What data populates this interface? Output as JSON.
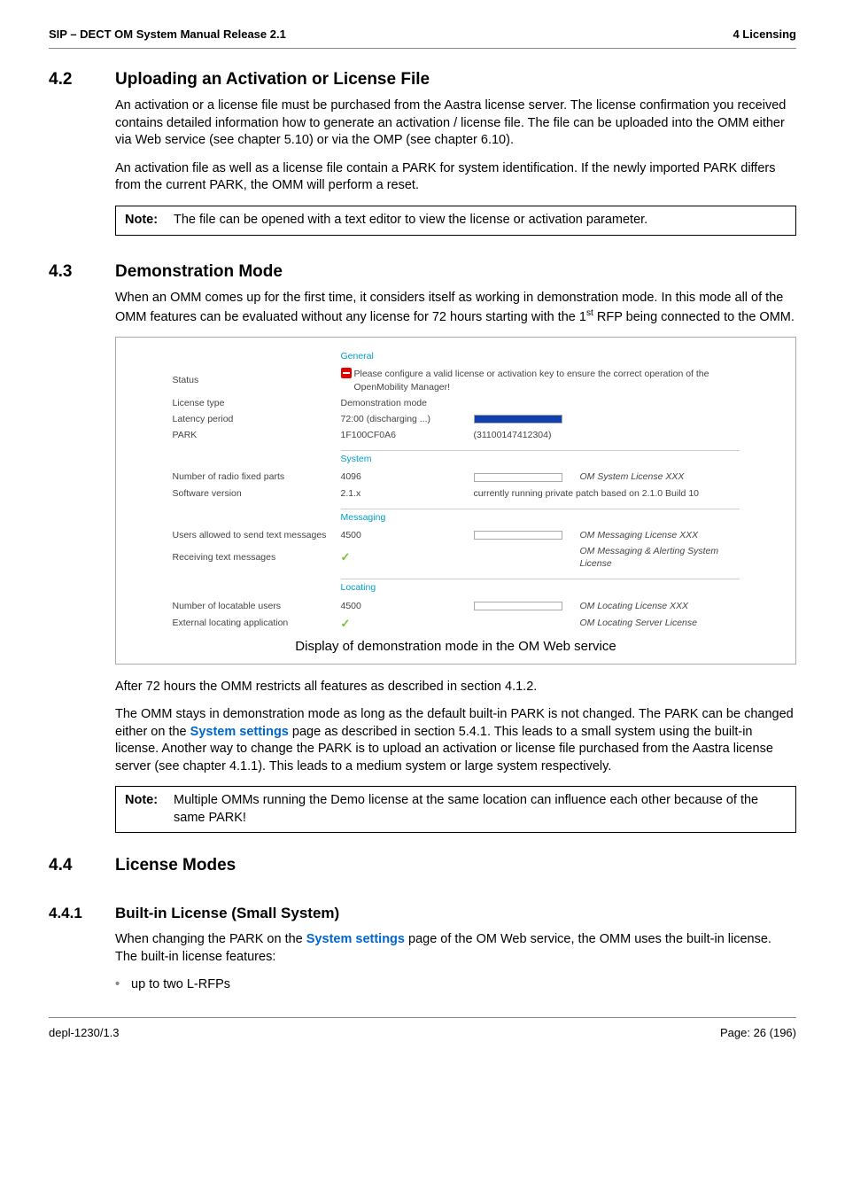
{
  "header": {
    "left": "SIP – DECT OM System Manual Release 2.1",
    "right": "4 Licensing"
  },
  "s42": {
    "num": "4.2",
    "title": "Uploading an Activation or License File",
    "p1": "An activation or a license file must be purchased from the Aastra license server. The license confirmation you received contains detailed information how to generate an activation / license file. The file can be uploaded into the OMM either via Web service (see chapter 5.10) or via the OMP (see chapter 6.10).",
    "p2": "An activation file as well as a license file contain a PARK for system identification. If the newly imported PARK differs from the current PARK, the OMM will perform a reset.",
    "note_label": "Note:",
    "note_text": "The file can be opened with a text editor to view the license or activation parameter."
  },
  "s43": {
    "num": "4.3",
    "title": "Demonstration Mode",
    "p1a": "When an OMM comes up for the first time, it considers itself as working in demonstration mode. In this mode all of the OMM features can be evaluated without any license for 72 hours starting with the 1",
    "p1b": " RFP being connected to the OMM.",
    "p_after1": "After 72 hours the OMM restricts all features as described in section 4.1.2.",
    "p_after2a": "The OMM stays in demonstration mode as long as the default built-in PARK is not changed. The PARK can be changed either on the ",
    "p_after2_link": "System settings",
    "p_after2b": " page as described in section 5.4.1. This leads to a small system using the built-in license. Another way to change the PARK is to upload an activation or license file purchased from the Aastra license server (see chapter 4.1.1). This leads to a medium system or large system respectively.",
    "note_label": "Note:",
    "note_text": "Multiple OMMs running the Demo license at the same location can influence each other because of the same PARK!"
  },
  "figure": {
    "general_h": "General",
    "status_l": "Status",
    "status_v": "Please configure a valid license or activation key to ensure the correct operation of the OpenMobility Manager!",
    "lictype_l": "License type",
    "lictype_v": "Demonstration mode",
    "latency_l": "Latency period",
    "latency_v": "72:00 (discharging ...)",
    "park_l": "PARK",
    "park_v1": "1F100CF0A6",
    "park_v2": "(31100147412304)",
    "system_h": "System",
    "nrfp_l": "Number of radio fixed parts",
    "nrfp_v": "4096",
    "nrfp_lic": "OM System License XXX",
    "sw_l": "Software version",
    "sw_v": "2.1.x",
    "sw_note": "currently running private patch based on 2.1.0 Build 10",
    "msg_h": "Messaging",
    "users_l": "Users allowed to send text messages",
    "users_v": "4500",
    "users_lic": "OM Messaging License XXX",
    "recv_l": "Receiving text messages",
    "recv_lic": "OM Messaging & Alerting System License",
    "loc_h": "Locating",
    "nloc_l": "Number of locatable users",
    "nloc_v": "4500",
    "nloc_lic": "OM Locating License XXX",
    "ext_l": "External locating application",
    "ext_lic": "OM Locating Server License",
    "caption": "Display of demonstration mode in the OM Web service"
  },
  "s44": {
    "num": "4.4",
    "title": "License Modes"
  },
  "s441": {
    "num": "4.4.1",
    "title": "Built-in License (Small System)",
    "p1a": "When changing the PARK on the ",
    "p1_link": "System settings",
    "p1b": " page of the OM Web service, the OMM uses the built-in license. The built-in license features:",
    "li1": "up to two L-RFPs"
  },
  "footer": {
    "left": "depl-1230/1.3",
    "right": "Page: 26 (196)"
  }
}
